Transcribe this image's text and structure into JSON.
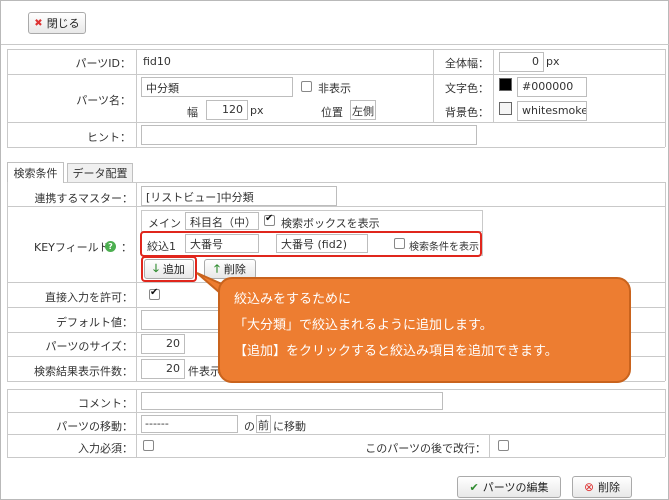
{
  "toolbar": {
    "close_label": "閉じる"
  },
  "props": {
    "parts_id_label": "パーツID：",
    "parts_id_value": "fid10",
    "total_width_label": "全体幅：",
    "total_width_value": "0",
    "px": "px",
    "parts_name_label": "パーツ名：",
    "parts_name_value": "中分類",
    "hide_label": "非表示",
    "text_color_label": "文字色：",
    "text_color_value": "#000000",
    "width_label": "幅",
    "width_value": "120",
    "position_label": "位置",
    "position_value": "左側",
    "bg_color_label": "背景色：",
    "bg_color_value": "whitesmoke",
    "hint_label": "ヒント："
  },
  "tabs": [
    "検索条件",
    "データ配置"
  ],
  "search": {
    "master_label": "連携するマスター：",
    "master_value": "[リストビュー]中分類",
    "key_label": "KEYフィールド",
    "key_colon": "：",
    "main_label": "メイン",
    "main_field": "科目名（中）",
    "show_search_box_label": "検索ボックスを表示",
    "filter_label": "絞込1",
    "filter_field": "大番号",
    "filter_target": "大番号 (fid2)",
    "show_condition_label": "検索条件を表示",
    "add_label": "追加",
    "delete_label": "削除",
    "direct_input_label": "直接入力を許可：",
    "default_label": "デフォルト値：",
    "size_label": "パーツのサイズ：",
    "size_value": "20",
    "results_label": "検索結果表示件数：",
    "results_value": "20",
    "results_unit": "件表示"
  },
  "footer": {
    "comment_label": "コメント：",
    "move_label": "パーツの移動：",
    "move_value": "------",
    "move_of": "の",
    "move_before": "前",
    "move_suffix": "に移動",
    "required_label": "入力必須：",
    "newline_label": "このパーツの後で改行：",
    "edit_button": "パーツの編集",
    "delete_button": "削除"
  },
  "callout": {
    "line1": "絞込みをするために",
    "line2": "「大分類」で絞込まれるように追加します。",
    "line3": "【追加】をクリックすると絞込み項目を追加できます。"
  },
  "colors": {
    "accent_red": "#e0261c",
    "callout_orange": "#ed7d31",
    "check_green": "#2e8b2e"
  }
}
